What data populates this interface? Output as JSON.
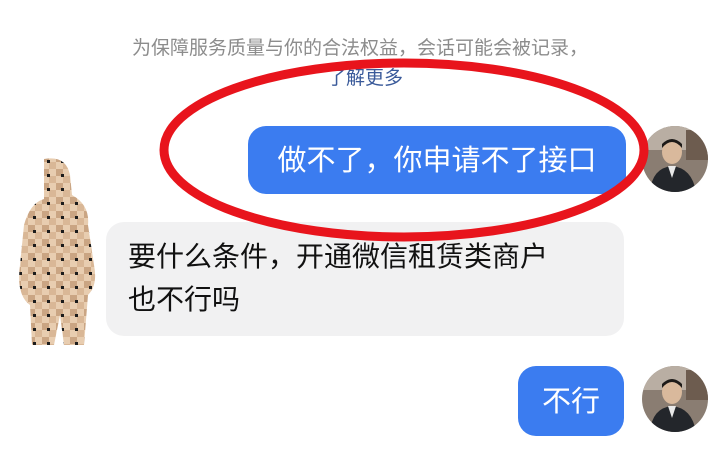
{
  "chat": {
    "notice_text": "为保障服务质量与你的合法权益，会话可能会被记录，",
    "notice_link": "了解更多",
    "messages": [
      {
        "sender": "self",
        "text": "做不了，你申请不了接口"
      },
      {
        "sender": "other",
        "lines": [
          "要什么条件，开通微信租赁类商户",
          "也不行吗"
        ]
      },
      {
        "sender": "self",
        "text": "不行"
      }
    ]
  },
  "annotation": {
    "ring_color": "#e8141c"
  },
  "colors": {
    "outgoing_bubble": "#3b7cf0",
    "incoming_bubble": "#f1f1f2",
    "notice_text": "#8c8c8c",
    "link_text": "#3a5a9a"
  },
  "icons": {
    "self_avatar": "person-photo-avatar",
    "other_avatar": "mosaic-masked-avatar"
  }
}
